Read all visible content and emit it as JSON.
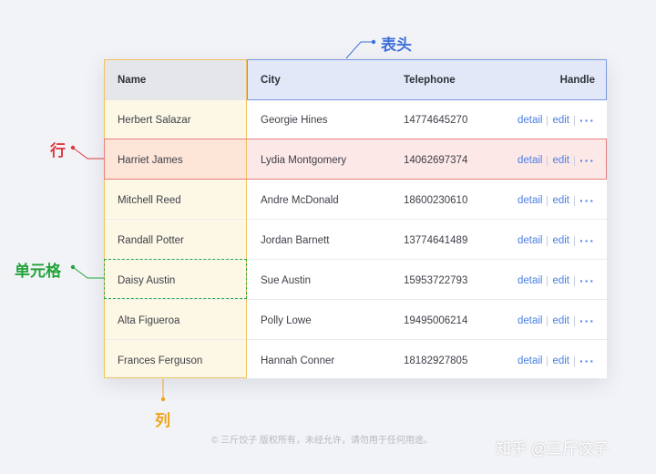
{
  "table": {
    "headers": {
      "name": "Name",
      "city": "City",
      "telephone": "Telephone",
      "handle": "Handle"
    },
    "rows": [
      {
        "name": "Herbert Salazar",
        "city": "Georgie Hines",
        "telephone": "14774645270"
      },
      {
        "name": "Harriet James",
        "city": "Lydia Montgomery",
        "telephone": "14062697374"
      },
      {
        "name": "Mitchell Reed",
        "city": "Andre McDonald",
        "telephone": "18600230610"
      },
      {
        "name": "Randall Potter",
        "city": "Jordan Barnett",
        "telephone": "13774641489"
      },
      {
        "name": "Daisy Austin",
        "city": "Sue Austin",
        "telephone": "15953722793"
      },
      {
        "name": "Alta Figueroa",
        "city": "Polly Lowe",
        "telephone": "19495006214"
      },
      {
        "name": "Frances Ferguson",
        "city": "Hannah Conner",
        "telephone": "18182927805"
      }
    ],
    "actions": {
      "detail": "detail",
      "edit": "edit",
      "more": "···"
    }
  },
  "callouts": {
    "header": "表头",
    "row": "行",
    "cell": "单元格",
    "column": "列"
  },
  "colors": {
    "header": "#3d6fd9",
    "row": "#e0393e",
    "cell": "#22a33a",
    "column": "#f0a21a"
  },
  "footer": {
    "copyright": "© 三斤饺子  版权所有，未经允许，请勿用于任何用途。",
    "watermark": "知乎 @三斤饺子"
  }
}
